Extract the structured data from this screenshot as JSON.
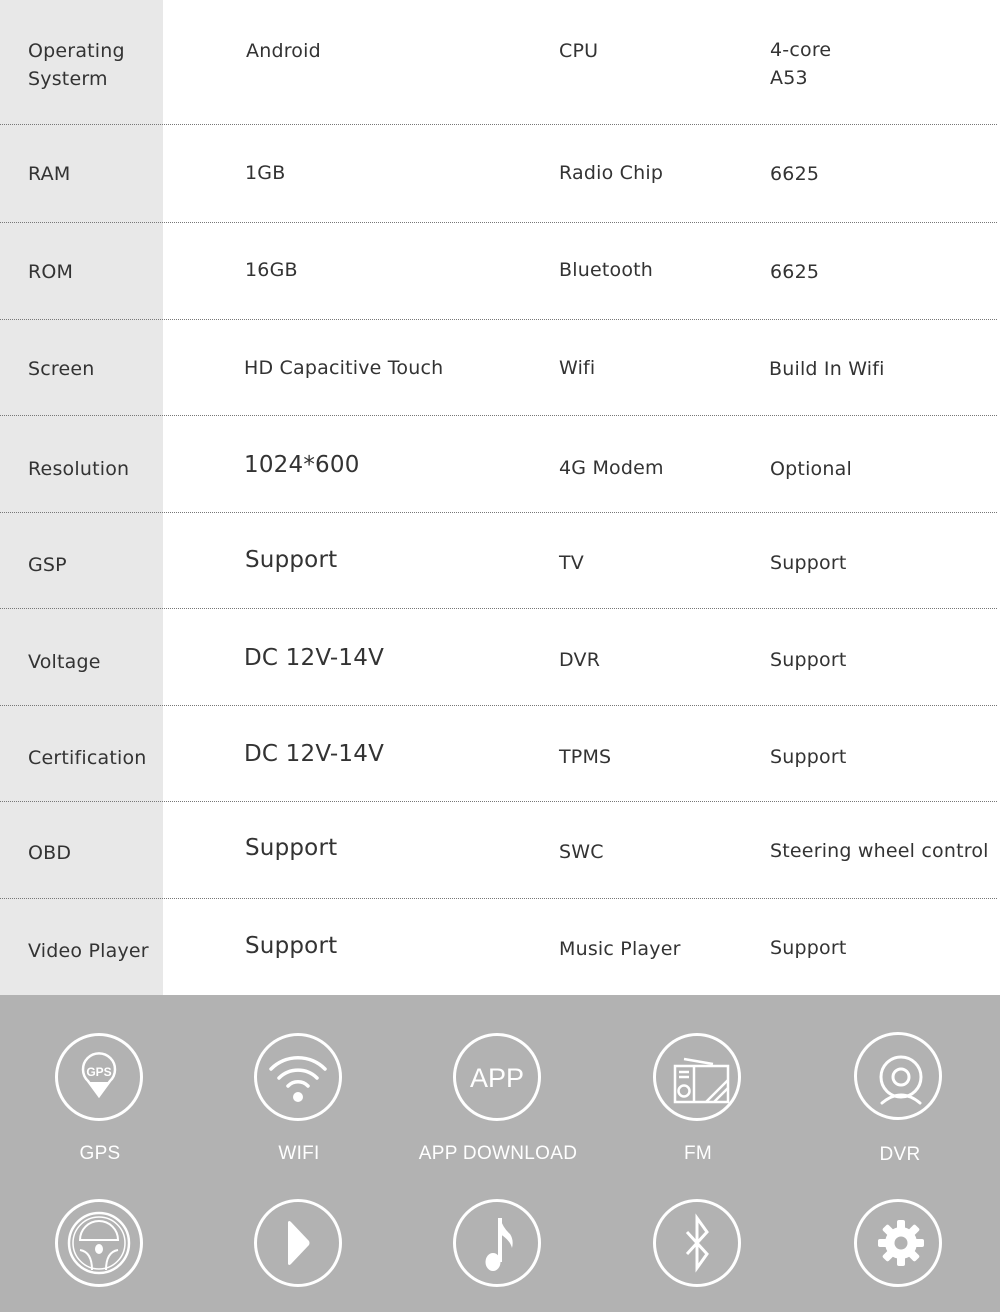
{
  "specs": {
    "rows": [
      {
        "label": "Operating\nSysterm",
        "value": "Android",
        "label2": "CPU",
        "value2": "4-core\nA53"
      },
      {
        "label": "RAM",
        "value": "1GB",
        "label2": "Radio Chip",
        "value2": "6625"
      },
      {
        "label": "ROM",
        "value": "16GB",
        "label2": "Bluetooth",
        "value2": "6625"
      },
      {
        "label": "Screen",
        "value": "HD Capacitive Touch",
        "label2": "Wifi",
        "value2": "Build In Wifi"
      },
      {
        "label": "Resolution",
        "value": "1024*600",
        "label2": "4G Modem",
        "value2": "Optional"
      },
      {
        "label": "GSP",
        "value": "Support",
        "label2": "TV",
        "value2": "Support"
      },
      {
        "label": "Voltage",
        "value": "DC 12V-14V",
        "label2": "DVR",
        "value2": "Support"
      },
      {
        "label": "Certification",
        "value": "DC 12V-14V",
        "label2": "TPMS",
        "value2": "Support"
      },
      {
        "label": "OBD",
        "value": "Support",
        "label2": "SWC",
        "value2": "Steering wheel control"
      },
      {
        "label": "Video Player",
        "value": "Support",
        "label2": "Music Player",
        "value2": "Support"
      }
    ]
  },
  "features": {
    "row1": [
      {
        "icon": "gps-pin-icon",
        "label": "GPS",
        "glyph": "GPS"
      },
      {
        "icon": "wifi-icon",
        "label": "WIFI"
      },
      {
        "icon": "app-icon",
        "label": "APP DOWNLOAD",
        "glyph": "APP"
      },
      {
        "icon": "radio-icon",
        "label": "FM"
      },
      {
        "icon": "webcam-icon",
        "label": "DVR"
      }
    ],
    "row2": [
      {
        "icon": "steering-wheel-icon"
      },
      {
        "icon": "play-icon"
      },
      {
        "icon": "music-note-icon"
      },
      {
        "icon": "bluetooth-icon"
      },
      {
        "icon": "gear-icon"
      }
    ]
  },
  "colors": {
    "label_column_bg": "#e8e8e8",
    "features_bg": "#b2b2b2",
    "text": "#333333",
    "icon": "#ffffff"
  }
}
